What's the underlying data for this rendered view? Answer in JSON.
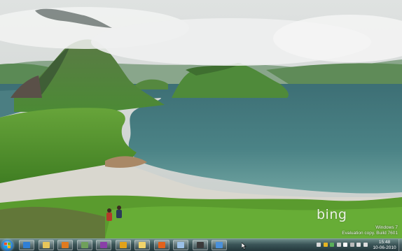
{
  "desktop": {
    "wallpaper_brand": "bing",
    "watermark": {
      "line1": "Windows 7",
      "line2": "Evaluation copy. Build 7601"
    }
  },
  "taskbar": {
    "start_icon": "windows-logo-icon",
    "pinned": [
      {
        "icon": "internet-explorer-icon",
        "color": "#2f7fd6"
      },
      {
        "icon": "windows-explorer-folder-icon",
        "color": "#e8c65a"
      },
      {
        "icon": "media-player-icon",
        "color": "#e07a1f"
      },
      {
        "icon": "landscape-image-icon",
        "color": "#6fa05a"
      },
      {
        "icon": "onenote-icon",
        "color": "#8a3fa8"
      },
      {
        "icon": "outlook-icon",
        "color": "#e3a21a"
      },
      {
        "icon": "weather-cloud-icon",
        "color": "#f0d36a"
      },
      {
        "icon": "firefox-icon",
        "color": "#e2621b"
      },
      {
        "icon": "document-icon",
        "color": "#9ac0e6"
      },
      {
        "icon": "owl-icon",
        "color": "#3a3a3a"
      },
      {
        "icon": "network-globe-icon",
        "color": "#4a90d9"
      }
    ],
    "tray": [
      {
        "icon": "flag-icon",
        "color": "#d9d9d9"
      },
      {
        "icon": "app-tray-icon",
        "color": "#e6b422"
      },
      {
        "icon": "app-tray-icon-2",
        "color": "#5ab05a"
      },
      {
        "icon": "app-tray-icon-3",
        "color": "#cccccc"
      },
      {
        "icon": "chat-icon",
        "color": "#ffffff"
      },
      {
        "icon": "update-icon",
        "color": "#bbbbbb"
      },
      {
        "icon": "network-icon",
        "color": "#dddddd"
      },
      {
        "icon": "volume-icon",
        "color": "#dddddd"
      }
    ],
    "clock": {
      "time": "15:48",
      "date": "10-06-2010"
    }
  }
}
